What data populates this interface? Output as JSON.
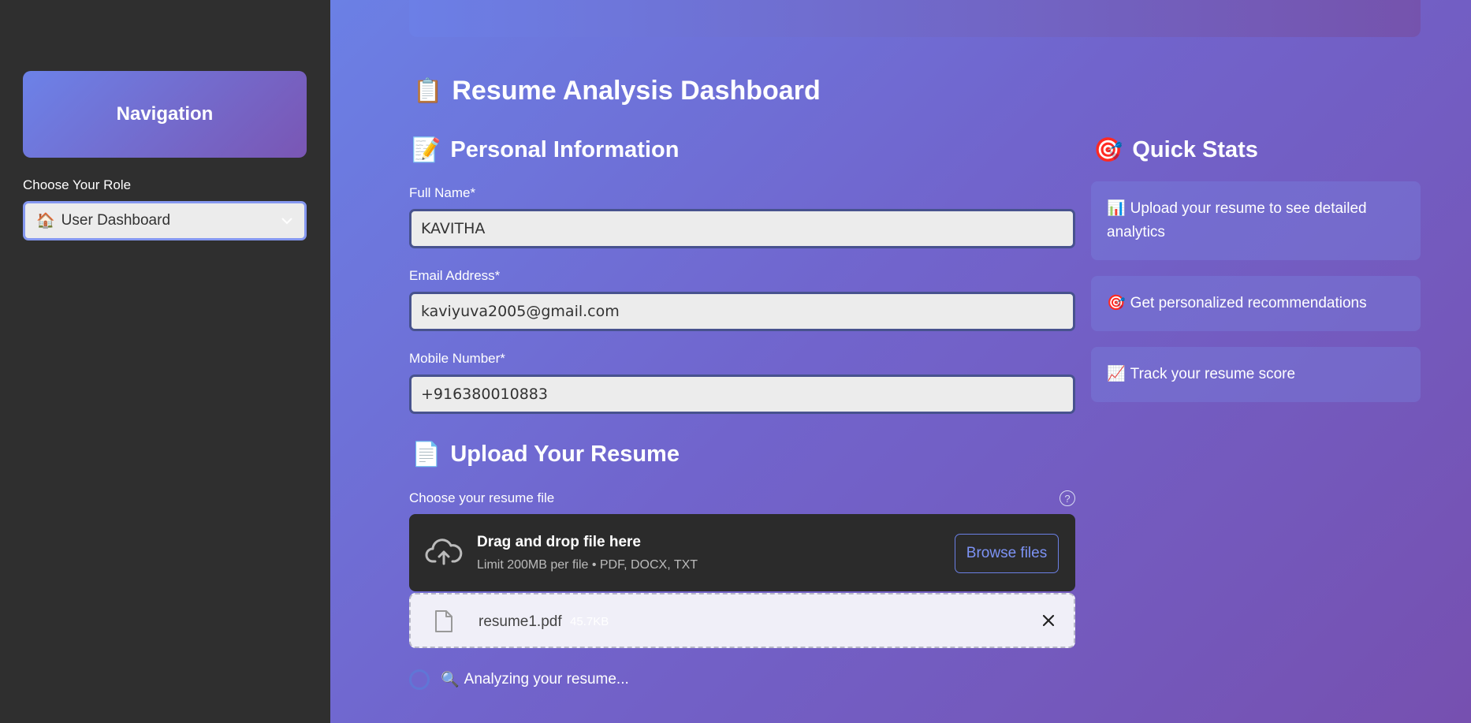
{
  "sidebar": {
    "title": "Navigation",
    "role_label": "Choose Your Role",
    "role_icon": "🏠",
    "role_value": "User Dashboard"
  },
  "main": {
    "dashboard_title": "Resume Analysis Dashboard",
    "dashboard_icon": "📋",
    "personal": {
      "title": "Personal Information",
      "icon": "📝",
      "full_name_label": "Full Name*",
      "full_name_value": "KAVITHA",
      "email_label": "Email Address*",
      "email_value": "kaviyuva2005@gmail.com",
      "mobile_label": "Mobile Number*",
      "mobile_value": "+916380010883"
    },
    "upload": {
      "title": "Upload Your Resume",
      "icon": "📄",
      "choose_label": "Choose your resume file",
      "help": "?",
      "drag_text": "Drag and drop file here",
      "limit_text": "Limit 200MB per file • PDF, DOCX, TXT",
      "browse_label": "Browse files",
      "file_name": "resume1.pdf",
      "file_size": "45.7KB"
    },
    "status": {
      "icon": "🔍",
      "text": "Analyzing your resume..."
    },
    "quick_stats": {
      "title": "Quick Stats",
      "icon": "🎯",
      "items": [
        {
          "icon": "📊",
          "text": "Upload your resume to see detailed analytics"
        },
        {
          "icon": "🎯",
          "text": "Get personalized recommendations"
        },
        {
          "icon": "📈",
          "text": "Track your resume score"
        }
      ]
    }
  },
  "colors": {
    "sidebar_bg": "#2f2f2f",
    "gradient_start": "#6b80e5",
    "gradient_end": "#7650b0",
    "accent": "#7d93f5"
  }
}
